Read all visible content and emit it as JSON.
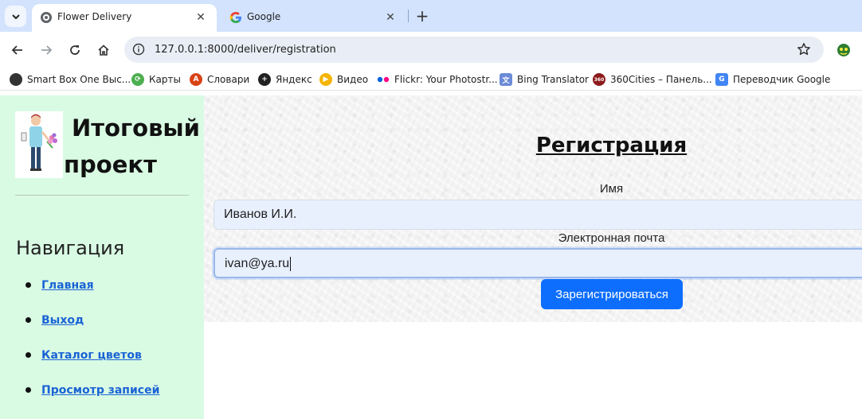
{
  "browser": {
    "tabs": [
      {
        "title": "Flower Delivery",
        "active": true
      },
      {
        "title": "Google",
        "active": false
      }
    ],
    "url": "127.0.0.1:8000/deliver/registration",
    "bookmarks": [
      {
        "label": "Smart Box One Выс...",
        "icon": "tv-icon",
        "color": "#333333"
      },
      {
        "label": "Карты",
        "icon": "maps-icon",
        "color": "#4caf50"
      },
      {
        "label": "Словари",
        "icon": "dictionary-icon",
        "color": "#d84315"
      },
      {
        "label": "Яндекс",
        "icon": "yandex-icon",
        "color": "#222222"
      },
      {
        "label": "Видео",
        "icon": "play-icon",
        "color": "#f4b400"
      },
      {
        "label": "Flickr: Your Photostr...",
        "icon": "flickr-icon",
        "color": "#ff0084"
      },
      {
        "label": "Bing Translator",
        "icon": "translator-icon",
        "color": "#6b8bd6"
      },
      {
        "label": "360Cities – Панель...",
        "icon": "360cities-icon",
        "color": "#8b1a1a"
      },
      {
        "label": "Переводчик Google",
        "icon": "google-translate-icon",
        "color": "#4285f4"
      }
    ]
  },
  "sidebar": {
    "brand": {
      "line1": "Итоговый",
      "line2": "проект"
    },
    "nav_title": "Навигация",
    "items": [
      {
        "label": "Главная"
      },
      {
        "label": "Выход"
      },
      {
        "label": "Каталог цветов"
      },
      {
        "label": "Просмотр записей"
      }
    ]
  },
  "form": {
    "title": "Регистрация",
    "name_label": "Имя",
    "name_value": "Иванов И.И.",
    "email_label": "Электронная почта",
    "email_value": "ivan@ya.ru",
    "submit_label": "Зарегистрироваться"
  },
  "colors": {
    "sidebar_bg": "#d9fbe3",
    "link": "#1a63d6",
    "primary_button": "#0d6efd",
    "input_bg": "#e8f0fe"
  }
}
